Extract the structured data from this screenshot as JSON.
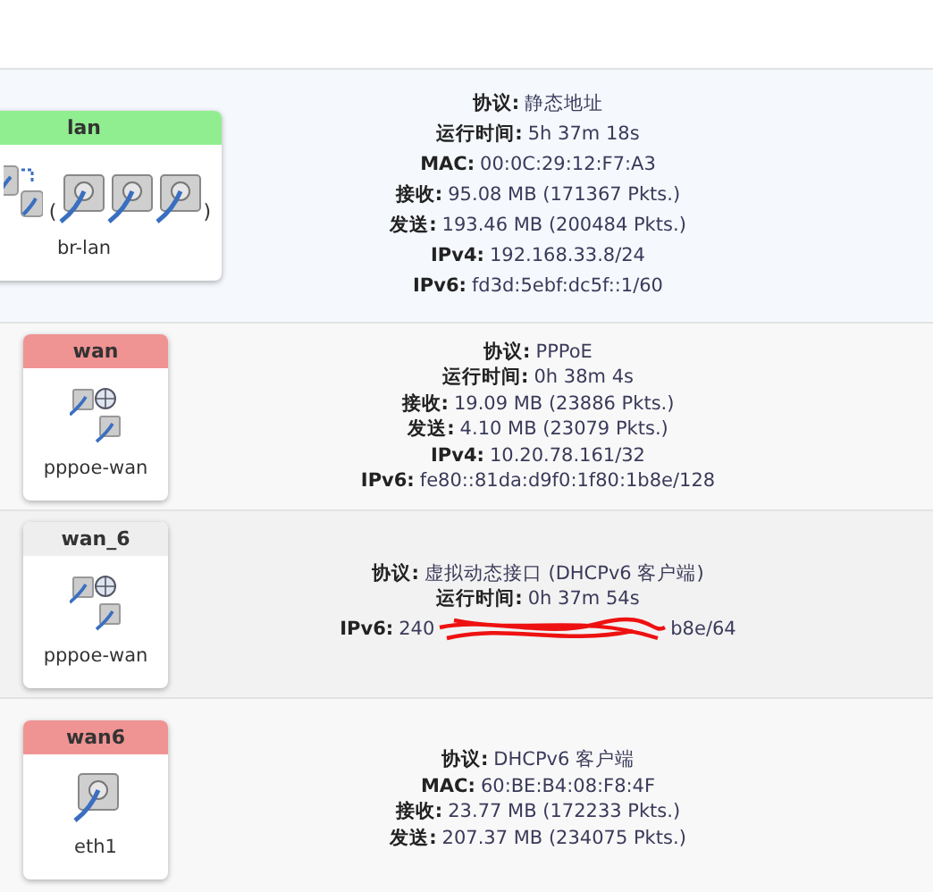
{
  "interfaces": [
    {
      "name": "lan",
      "color": "#90ee90",
      "device": "br-lan",
      "icons": [
        {
          "kind": "bridge"
        }
      ],
      "bracket_open": "(",
      "members": [
        {
          "kind": "port"
        },
        {
          "kind": "port"
        },
        {
          "kind": "port"
        }
      ],
      "bracket_close": ")",
      "info": [
        {
          "label": "协议:",
          "value": "静态地址"
        },
        {
          "label": "运行时间:",
          "value": "5h 37m 18s"
        },
        {
          "label": "MAC:",
          "value": "00:0C:29:12:F7:A3"
        },
        {
          "label": "接收:",
          "value": "95.08 MB (171367 Pkts.)"
        },
        {
          "label": "发送:",
          "value": "193.46 MB (200484 Pkts.)"
        },
        {
          "label": "IPv4:",
          "value": "192.168.33.8/24"
        },
        {
          "label": "IPv6:",
          "value": "fd3d:5ebf:dc5f::1/60"
        }
      ]
    },
    {
      "name": "wan",
      "color": "#f09393",
      "device": "pppoe-wan",
      "icons": [
        {
          "kind": "pppoe"
        }
      ],
      "info": [
        {
          "label": "协议:",
          "value": "PPPoE"
        },
        {
          "label": "运行时间:",
          "value": "0h 38m 4s"
        },
        {
          "label": "接收:",
          "value": "19.09 MB (23886 Pkts.)"
        },
        {
          "label": "发送:",
          "value": "4.10 MB (23079 Pkts.)"
        },
        {
          "label": "IPv4:",
          "value": "10.20.78.161/32"
        },
        {
          "label": "IPv6:",
          "value": "fe80::81da:d9f0:1f80:1b8e/128"
        }
      ]
    },
    {
      "name": "wan_6",
      "color": "#eeeeee",
      "device": "pppoe-wan",
      "icons": [
        {
          "kind": "pppoe"
        }
      ],
      "info": [
        {
          "label": "协议:",
          "value": "虚拟动态接口 (DHCPv6 客户端)"
        },
        {
          "label": "运行时间:",
          "value": "0h 37m 54s"
        },
        {
          "label": "IPv6:",
          "value": "240",
          "value_end": "b8e/64",
          "redacted": true
        }
      ]
    },
    {
      "name": "wan6",
      "color": "#f09393",
      "device": "eth1",
      "icons": [
        {
          "kind": "port"
        }
      ],
      "info": [
        {
          "label": "协议:",
          "value": "DHCPv6 客户端"
        },
        {
          "label": "MAC:",
          "value": "60:BE:B4:08:F8:4F"
        },
        {
          "label": "接收:",
          "value": "23.77 MB (172233 Pkts.)"
        },
        {
          "label": "发送:",
          "value": "207.37 MB (234075 Pkts.)"
        }
      ]
    }
  ]
}
